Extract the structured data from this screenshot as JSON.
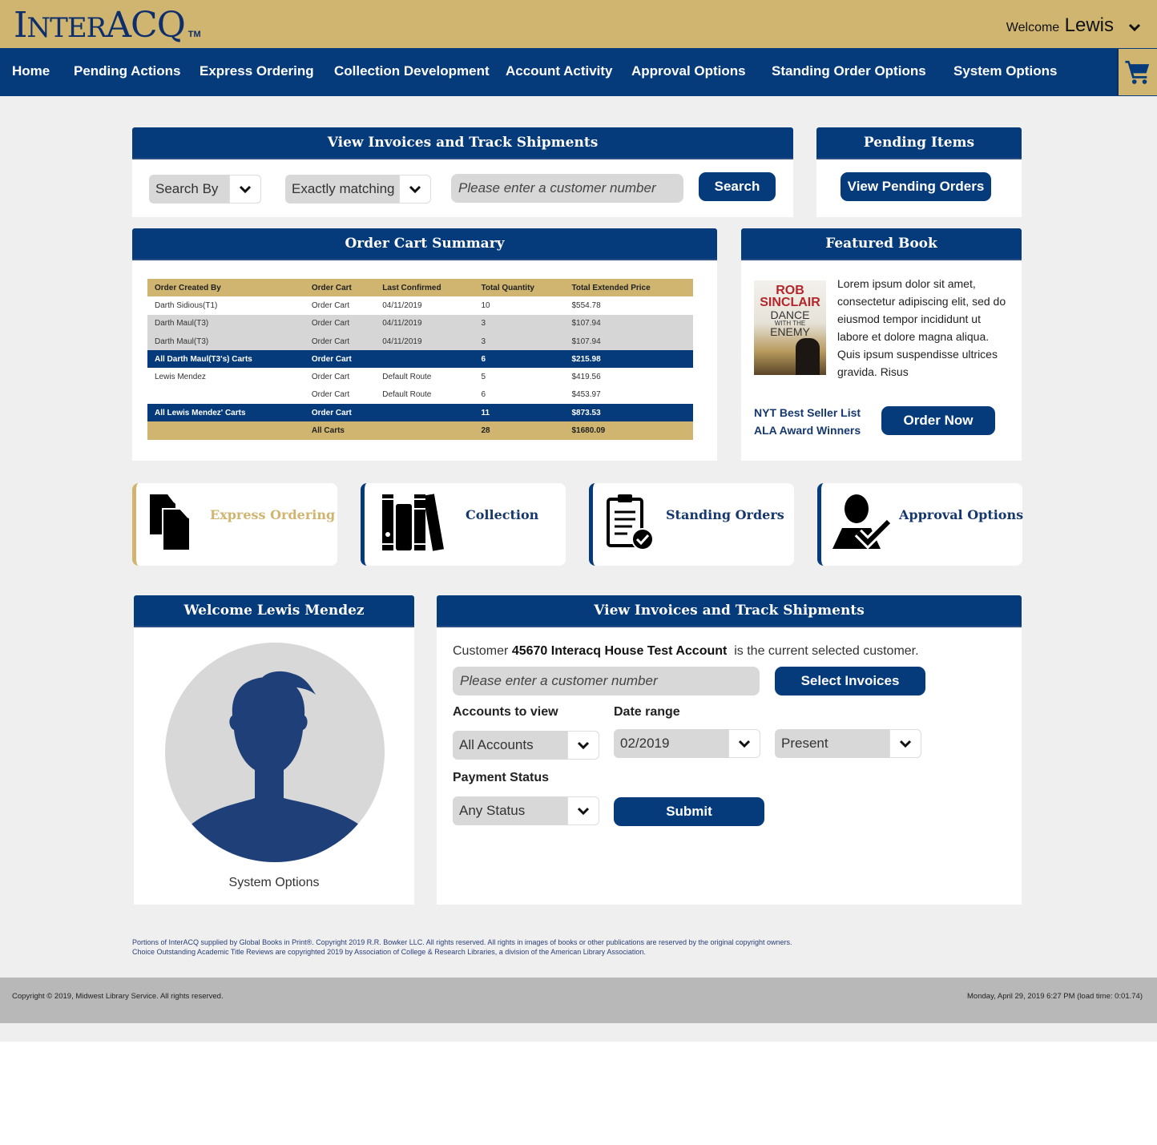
{
  "header": {
    "logo_main": "INTERACQ",
    "logo_tm": "TM",
    "welcome_prefix": "Welcome",
    "welcome_name": "Lewis",
    "user_menu_icon": "chevron-down-icon"
  },
  "nav": {
    "items": [
      {
        "label": "Home"
      },
      {
        "label": "Pending Actions"
      },
      {
        "label": "Express Ordering"
      },
      {
        "label": "Collection Development"
      },
      {
        "label": "Account Activity"
      },
      {
        "label": "Approval Options"
      },
      {
        "label": "Standing Order Options"
      },
      {
        "label": "System Options"
      }
    ],
    "cart_icon": "shopping-cart-icon"
  },
  "invoice_search": {
    "title": "View Invoices and Track Shipments",
    "search_by": "Search By",
    "match_mode": "Exactly matching",
    "placeholder": "Please enter a customer number",
    "value": "",
    "search_label": "Search"
  },
  "pending": {
    "title": "Pending Items",
    "button_label": "View Pending Orders"
  },
  "cart_summary": {
    "title": "Order Cart Summary",
    "columns": [
      "Order Created By",
      "Order Cart",
      "Last Confirmed",
      "Total Quantity",
      "Total Extended Price"
    ],
    "rows": [
      {
        "type": "plain",
        "cells": [
          "Darth Sidious(T1)",
          "Order Cart",
          "04/11/2019",
          "10",
          "$554.78"
        ]
      },
      {
        "type": "grey",
        "cells": [
          "Darth Maul(T3)",
          "Order Cart",
          "04/11/2019",
          "3",
          "$107.94"
        ]
      },
      {
        "type": "grey",
        "cells": [
          "Darth Maul(T3)",
          "Order Cart",
          "04/11/2019",
          "3",
          "$107.94"
        ]
      },
      {
        "type": "sub",
        "cells": [
          "All Darth Maul(T3's) Carts",
          "Order Cart",
          "",
          "6",
          "$215.98"
        ]
      },
      {
        "type": "plain",
        "cells": [
          "Lewis Mendez",
          "Order Cart",
          "Default Route",
          "5",
          "$419.56"
        ]
      },
      {
        "type": "plain",
        "cells": [
          "",
          "Order Cart",
          "Default Route",
          "6",
          "$453.97"
        ]
      },
      {
        "type": "sub",
        "cells": [
          "All Lewis Mendez' Carts",
          "Order Cart",
          "",
          "11",
          "$873.53"
        ]
      },
      {
        "type": "total",
        "cells": [
          "",
          "All Carts",
          "",
          "28",
          "$1680.09"
        ]
      }
    ]
  },
  "featured": {
    "title": "Featured Book",
    "cover": {
      "author_line1": "ROB",
      "author_line2": "SINCLAIR",
      "title_line1": "DANCE",
      "title_line2": "WITH THE",
      "title_line3": "ENEMY"
    },
    "description": "Lorem ipsum dolor sit amet, consectetur adipiscing elit, sed do eiusmod tempor incididunt ut labore et dolore magna aliqua. Quis ipsum suspendisse ultrices gravida. Risus",
    "link1": "NYT Best Seller List",
    "link2": "ALA Award Winners",
    "order_label": "Order Now"
  },
  "tiles": [
    {
      "label": "Express Ordering",
      "icon": "documents-icon"
    },
    {
      "label": "Collection",
      "icon": "books-icon"
    },
    {
      "label": "Standing Orders",
      "icon": "clipboard-check-icon"
    },
    {
      "label": "Approval Options",
      "icon": "user-check-icon"
    }
  ],
  "welcome_panel": {
    "title": "Welcome Lewis Mendez",
    "avatar_icon": "user-avatar-icon",
    "link": "System Options"
  },
  "invoice_panel": {
    "title": "View Invoices and Track Shipments",
    "customer_prefix": "Customer",
    "customer_name": "45670 Interacq House Test Account",
    "customer_suffix": "is the current selected customer.",
    "placeholder": "Please enter a customer number",
    "value": "",
    "select_invoices_label": "Select Invoices",
    "accounts_label": "Accounts to view",
    "accounts_value": "All Accounts",
    "date_label": "Date range",
    "date_from": "02/2019",
    "date_to": "Present",
    "payment_label": "Payment Status",
    "payment_value": "Any Status",
    "submit_label": "Submit"
  },
  "footnote": {
    "line1": "Portions of InterACQ supplied by Global Books in Print®. Copyright 2019 R.R. Bowker LLC. All rights reserved. All rights in images of books or other publications are reserved by the original copyright owners.",
    "line2": "Choice Outstanding Academic Title Reviews are copyrighted 2019 by Association of College & Research Libraries, a division of the American Library Association."
  },
  "footer": {
    "copyright": "Copyright © 2019, Midwest Library Service. All rights reserved.",
    "timestamp": "Monday, April 29, 2019 6:27 PM (load time: 0:01.74)"
  },
  "colors": {
    "navy": "#053b7b",
    "gold": "#cfb56f",
    "page_bg": "#efefef"
  }
}
